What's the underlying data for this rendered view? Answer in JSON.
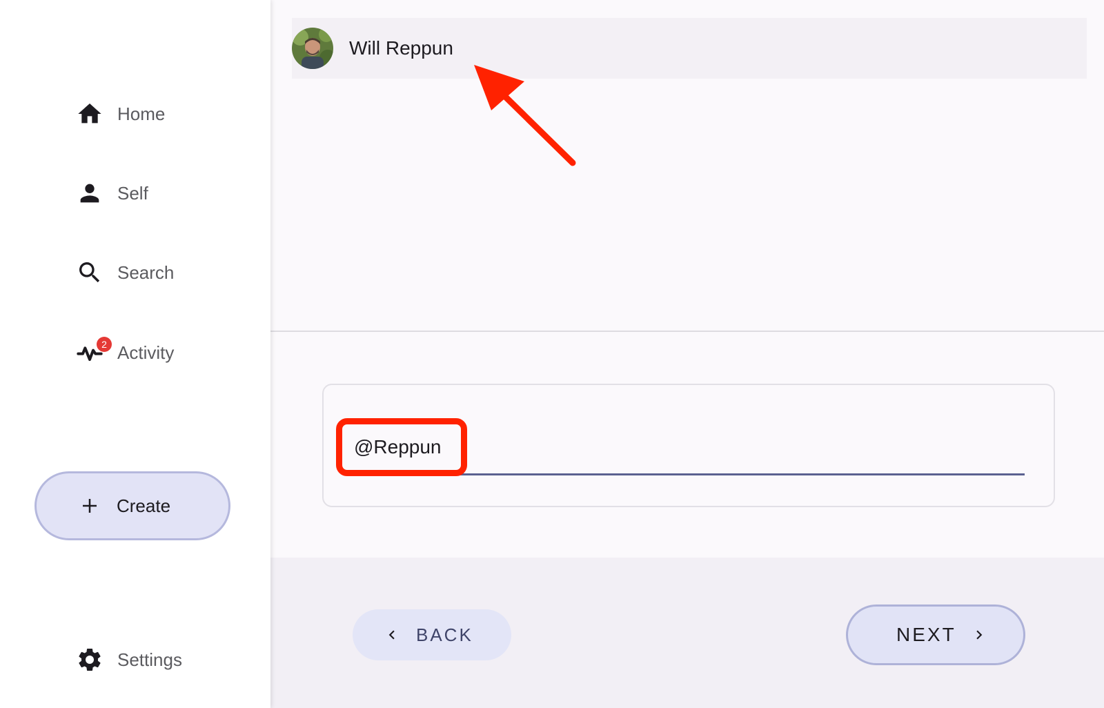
{
  "sidebar": {
    "items": [
      {
        "label": "Home",
        "icon": "home-icon"
      },
      {
        "label": "Self",
        "icon": "person-icon"
      },
      {
        "label": "Search",
        "icon": "search-icon"
      },
      {
        "label": "Activity",
        "icon": "activity-icon",
        "badge": "2"
      }
    ],
    "create_label": "Create",
    "settings_label": "Settings"
  },
  "main": {
    "user": {
      "name": "Will Reppun",
      "avatar": "avatar"
    },
    "handle_input": {
      "value": "@Reppun"
    },
    "back_label": "BACK",
    "next_label": "NEXT"
  },
  "colors": {
    "accent": "#5a6190",
    "button_fill": "#e2e3f6",
    "annotation": "#ff2200",
    "badge": "#e53935"
  }
}
